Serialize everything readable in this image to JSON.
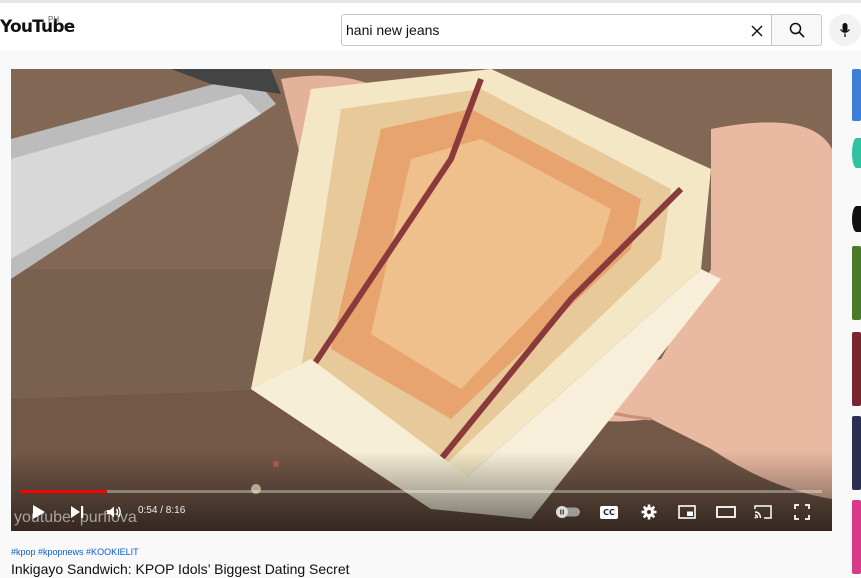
{
  "header": {
    "logo": "YouTube",
    "region": "PH",
    "search": {
      "value": "hani new jeans",
      "placeholder": "Search"
    }
  },
  "player": {
    "watermark": "youtube: purflova",
    "time": "0:54 / 8:16",
    "progress": 0.109,
    "cc_label": "CC"
  },
  "video": {
    "hashtags": "#kpop #kpopnews #KOOKIELIT",
    "title": "Inkigayo Sandwich: KPOP Idols’ Biggest Dating Secret"
  },
  "colors": {
    "accent": "#ff0000",
    "hashtag": "#065fd4"
  },
  "icons": [
    "search-icon",
    "close-icon",
    "mic-icon",
    "play-icon",
    "next-icon",
    "volume-icon",
    "autoplay-toggle",
    "captions-icon",
    "settings-icon",
    "miniplayer-icon",
    "theater-icon",
    "cast-icon",
    "fullscreen-icon"
  ]
}
